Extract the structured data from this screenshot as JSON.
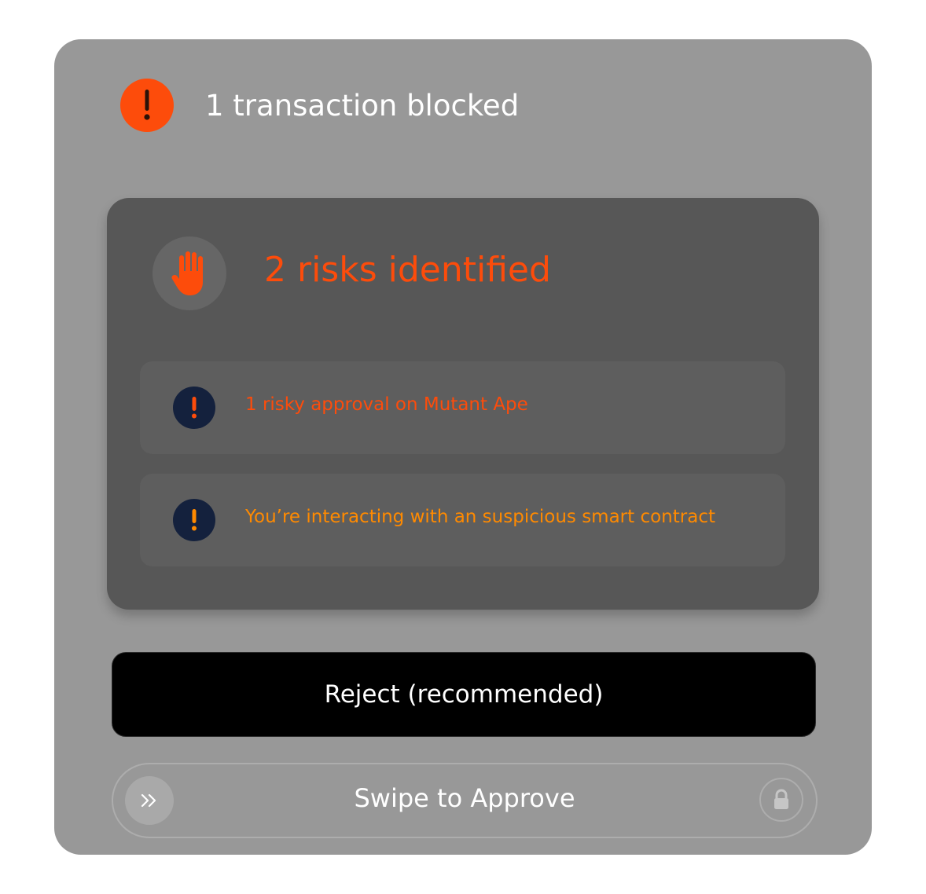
{
  "header": {
    "title": "1 transaction blocked",
    "badge_icon": "exclamation-icon"
  },
  "risk_card": {
    "title": "2 risks identified",
    "icon": "hand-stop-icon",
    "items": [
      {
        "text": "1 risky approval on Mutant Ape",
        "icon": "exclamation-icon",
        "color": "#fd4c0b"
      },
      {
        "text": "You’re interacting with an suspicious smart contract",
        "icon": "exclamation-icon",
        "color": "#ff8a00"
      }
    ]
  },
  "actions": {
    "reject_label": "Reject (recommended)",
    "swipe_label": "Swipe to Approve",
    "swipe_knob_icon": "double-chevron-right-icon",
    "lock_icon": "lock-icon"
  },
  "colors": {
    "accent": "#fd4c0b",
    "warning": "#ff8a00",
    "badge_dark": "#14213d"
  }
}
